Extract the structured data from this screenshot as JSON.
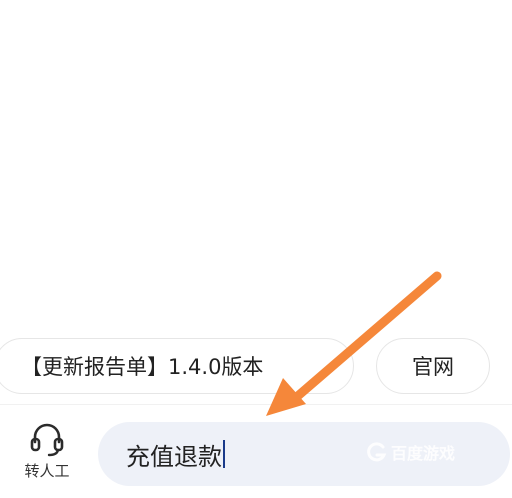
{
  "quick_replies": {
    "release_notes": "【更新报告单】1.4.0版本",
    "official_site": "官网"
  },
  "bottom_bar": {
    "agent_button_label": "转人工",
    "input_value": "充值退款"
  },
  "watermark": {
    "text": "百度游戏"
  },
  "colors": {
    "annotation_arrow": "#f5873a",
    "input_background": "#eef1f8",
    "caret": "#1a3a8a"
  },
  "icons": {
    "agent": "headset-icon",
    "watermark": "baidu-game-logo-icon",
    "annotation": "arrow-pointer-icon"
  }
}
